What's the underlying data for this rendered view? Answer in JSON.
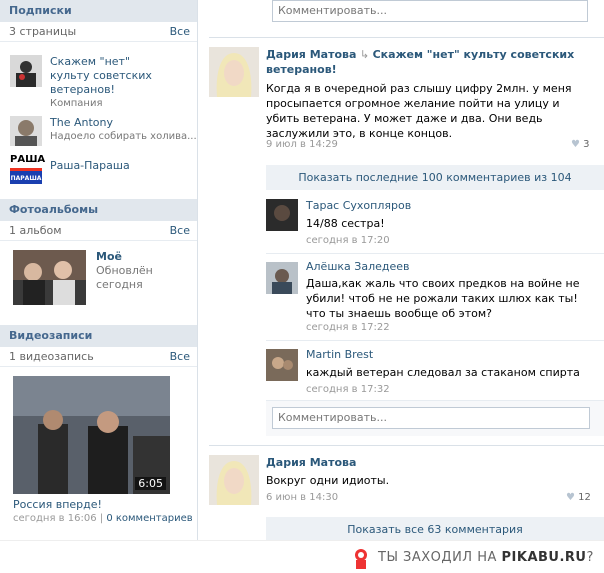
{
  "subscriptions": {
    "title": "Подписки",
    "count": "3 страницы",
    "all": "Все",
    "items": [
      {
        "name": "Скажем \"нет\" культу советских ветеранов!",
        "desc": "Компания"
      },
      {
        "name": "The Antony",
        "desc": "Надоело собирать холива..."
      },
      {
        "name": "Раша-Параша",
        "desc": "",
        "logo_top": "РАША",
        "logo_bottom": "ПАРАША"
      }
    ]
  },
  "albums": {
    "title": "Фотоальбомы",
    "count": "1 альбом",
    "all": "Все",
    "album": {
      "name": "Моё",
      "updated": "Обновлён",
      "when": "сегодня"
    }
  },
  "videos": {
    "title": "Видеозаписи",
    "count": "1 видеозапись",
    "all": "Все",
    "video": {
      "title": "Россия вперде!",
      "duration": "6:05",
      "date": "сегодня в 16:06",
      "sep": "|",
      "comments": "0 комментариев"
    }
  },
  "top_comment": {
    "placeholder": "Комментировать..."
  },
  "post1": {
    "author": "Дария Матова",
    "arrow": "↳",
    "target": "Скажем \"нет\" культу советских ветеранов!",
    "text": "Когда я в очередной раз слышу цифру 2млн. у меня просыпается огромное желание пойти на улицу и убить ветерана. У может даже и два. Они ведь заслужили это, в конце концов.",
    "date": "9 июл в 14:29",
    "likes": "3",
    "show_more": "Показать последние 100 комментариев из 104",
    "comments": [
      {
        "author": "Тарас Сухопляров",
        "text": "14/88 сестра!",
        "date": "сегодня в 17:20"
      },
      {
        "author": "Алёшка Заледеев",
        "text": "Даша,как жаль что своих предков на войне не убили! чтоб не не рожали таких шлюх как ты!что ты знаешь вообще об этом?",
        "date": "сегодня в 17:22"
      },
      {
        "author": "Martin Brest",
        "text": "каждый ветеран следовал за стаканом спирта",
        "date": "сегодня в 17:32"
      }
    ],
    "comment_placeholder": "Комментировать..."
  },
  "post2": {
    "author": "Дария Матова",
    "text": "Вокруг одни идиоты.",
    "date": "6 июн в 14:30",
    "likes": "12",
    "show_all": "Показать все 63 комментария"
  },
  "watermark": {
    "prefix": "ТЫ ЗАХОДИЛ НА ",
    "site": "PIKABU.RU",
    "suffix": "?"
  }
}
